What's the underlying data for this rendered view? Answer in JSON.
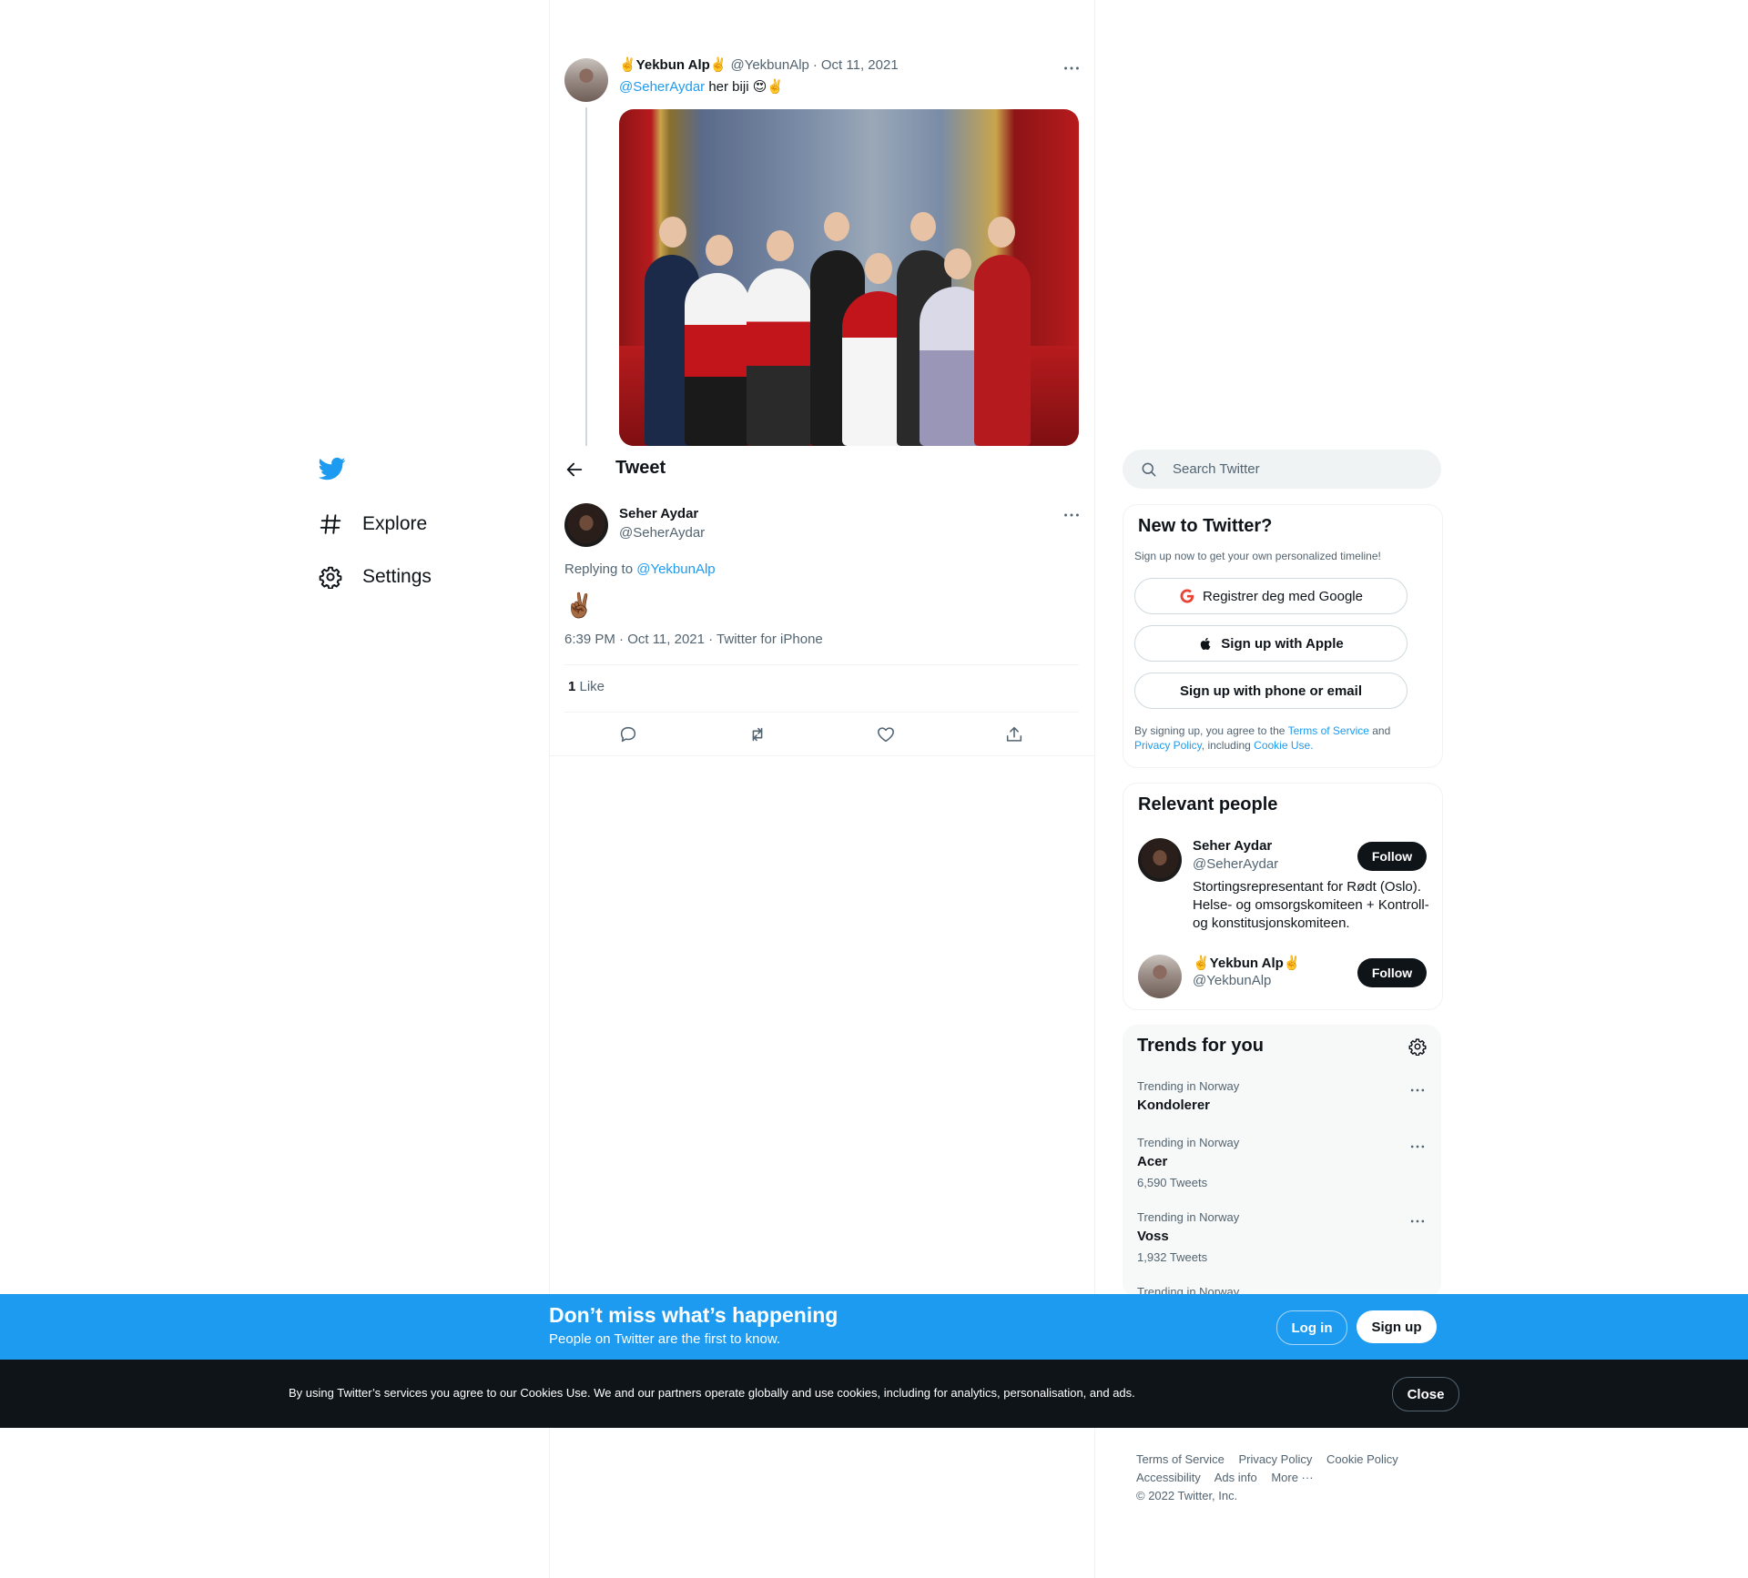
{
  "nav": {
    "items": [
      {
        "label": "Explore",
        "icon": "hashtag-icon"
      },
      {
        "label": "Settings",
        "icon": "gear-icon"
      }
    ]
  },
  "header": {
    "title": "Tweet"
  },
  "parent_tweet": {
    "name": "✌️Yekbun Alp✌️",
    "handle": "@YekbunAlp",
    "separator": "·",
    "date": "Oct 11, 2021",
    "mention": "@SeherAydar",
    "text": " her biji 😍✌️"
  },
  "main_tweet": {
    "name": "Seher Aydar",
    "handle": "@SeherAydar",
    "replying_prefix": "Replying to ",
    "replying_to": "@YekbunAlp",
    "text": "✌🏾",
    "timestamp": "6:39 PM · Oct 11, 2021 · Twitter for iPhone",
    "like_count": "1",
    "like_label": " Like"
  },
  "search": {
    "placeholder": "Search Twitter"
  },
  "new_to_twitter": {
    "title": "New to Twitter?",
    "subtitle": "Sign up now to get your own personalized timeline!",
    "google_label": "Registrer deg med Google",
    "apple_label": "Sign up with Apple",
    "phone_label": "Sign up with phone or email",
    "legal_1": "By signing up, you agree to the ",
    "terms": "Terms of Service",
    "legal_2": " and",
    "privacy": "Privacy Policy",
    "legal_3": ", including ",
    "cookie": "Cookie Use."
  },
  "relevant": {
    "title": "Relevant people",
    "people": [
      {
        "name": "Seher Aydar",
        "handle": "@SeherAydar",
        "bio": "Stortingsrepresentant for Rødt (Oslo). Helse- og omsorgskomiteen + Kontroll- og konstitusjonskomiteen.",
        "follow": "Follow"
      },
      {
        "name": "✌️Yekbun Alp✌️",
        "handle": "@YekbunAlp",
        "follow": "Follow"
      }
    ]
  },
  "trends": {
    "title": "Trends for you",
    "items": [
      {
        "context": "Trending in Norway",
        "name": "Kondolerer",
        "count": ""
      },
      {
        "context": "Trending in Norway",
        "name": "Acer",
        "count": "6,590 Tweets"
      },
      {
        "context": "Trending in Norway",
        "name": "Voss",
        "count": "1,932 Tweets"
      },
      {
        "context": "Trending in Norway",
        "name": "",
        "count": ""
      }
    ]
  },
  "signup_bar": {
    "title": "Don’t miss what’s happening",
    "subtitle": "People on Twitter are the first to know.",
    "login": "Log in",
    "signup": "Sign up"
  },
  "cookie_bar": {
    "text": "By using Twitter’s services you agree to our Cookies Use. We and our partners operate globally and use cookies, including for analytics, personalisation, and ads.",
    "close": "Close"
  },
  "footer": {
    "links_row1": [
      "Terms of Service",
      "Privacy Policy",
      "Cookie Policy"
    ],
    "links_row2": [
      "Accessibility",
      "Ads info",
      "More ···"
    ],
    "copyright": "© 2022 Twitter, Inc."
  },
  "colors": {
    "accent": "#1d9bf0",
    "text": "#0f1419",
    "muted": "#536471",
    "dark_bar": "#0f1419"
  }
}
